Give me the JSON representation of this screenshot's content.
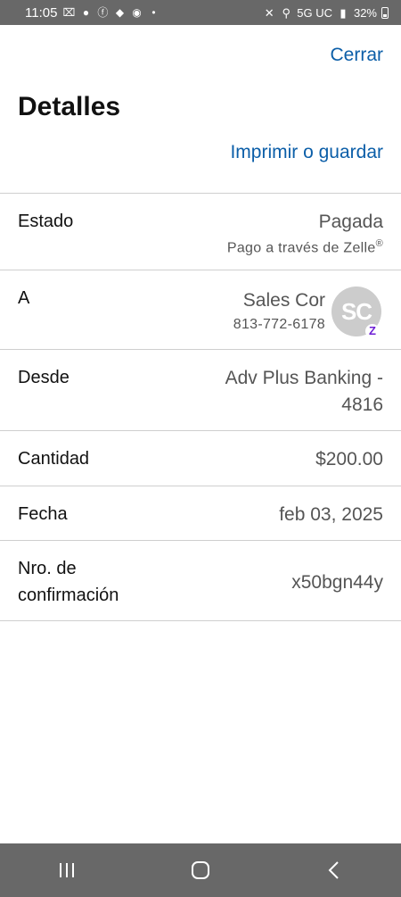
{
  "status_bar": {
    "time": "11:05",
    "network": "5G UC",
    "battery": "32%"
  },
  "header": {
    "close_label": "Cerrar",
    "title": "Detalles",
    "print_label": "Imprimir o guardar"
  },
  "details": {
    "estado": {
      "label": "Estado",
      "value": "Pagada",
      "sub": "Pago a través de Zelle",
      "sub_mark": "®"
    },
    "a": {
      "label": "A",
      "name": "Sales Cor",
      "phone": "813-772-6178",
      "avatar_initials": "SC",
      "badge": "Z"
    },
    "desde": {
      "label": "Desde",
      "value_line1": "Adv Plus Banking -",
      "value_line2": "4816"
    },
    "cantidad": {
      "label": "Cantidad",
      "value": "$200.00"
    },
    "fecha": {
      "label": "Fecha",
      "value": "feb 03, 2025"
    },
    "confirmacion": {
      "label_line1": "Nro. de",
      "label_line2": "confirmación",
      "value": "x50bgn44y"
    }
  },
  "colors": {
    "link": "#0b5ea8",
    "zelle": "#6d1ed4",
    "bars": "#686868"
  }
}
